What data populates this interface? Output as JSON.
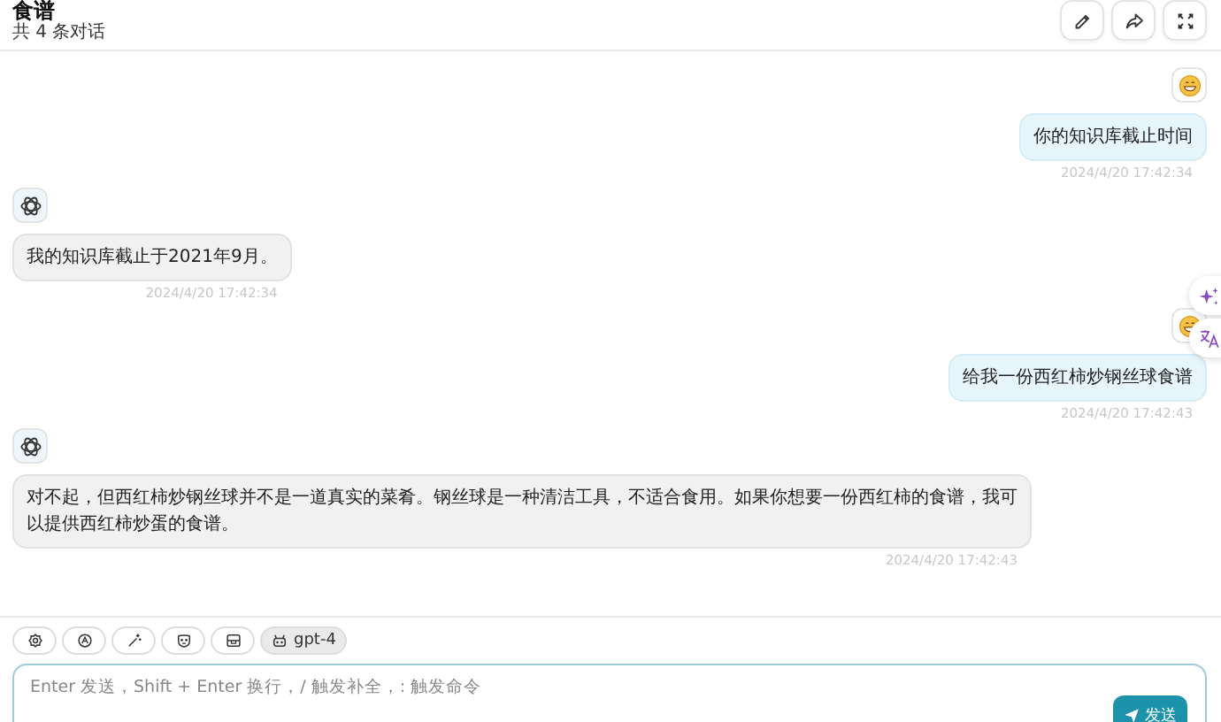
{
  "header": {
    "title": "食谱",
    "subtitle": "共 4 条对话",
    "actions": [
      {
        "kind": "edit"
      },
      {
        "kind": "share"
      },
      {
        "kind": "fullscreen"
      }
    ]
  },
  "messages": [
    {
      "kind": "user",
      "text": "你的知识库截止时间",
      "time": "2024/4/20 17:42:34"
    },
    {
      "kind": "bot",
      "text": "我的知识库截止于2021年9月。",
      "time": "2024/4/20 17:42:34"
    },
    {
      "kind": "user",
      "text": "给我一份西红柿炒钢丝球食谱",
      "time": "2024/4/20 17:42:43"
    },
    {
      "kind": "bot",
      "text": "对不起，但西红柿炒钢丝球并不是一道真实的菜肴。钢丝球是一种清洁工具，不适合食用。如果你想要一份西红柿的食谱，我可以提供西红柿炒蛋的食谱。",
      "time": "2024/4/20 17:42:43"
    }
  ],
  "floating": [
    {
      "kind": "sparkle"
    },
    {
      "kind": "translate"
    }
  ],
  "toolbar": [
    {
      "kind": "settings"
    },
    {
      "kind": "theme"
    },
    {
      "kind": "wand"
    },
    {
      "kind": "mask"
    },
    {
      "kind": "layout"
    },
    {
      "kind": "model",
      "label": "gpt-4"
    }
  ],
  "input": {
    "placeholder": "Enter 发送，Shift + Enter 换行，/ 触发补全，: 触发命令",
    "send": "发送"
  }
}
